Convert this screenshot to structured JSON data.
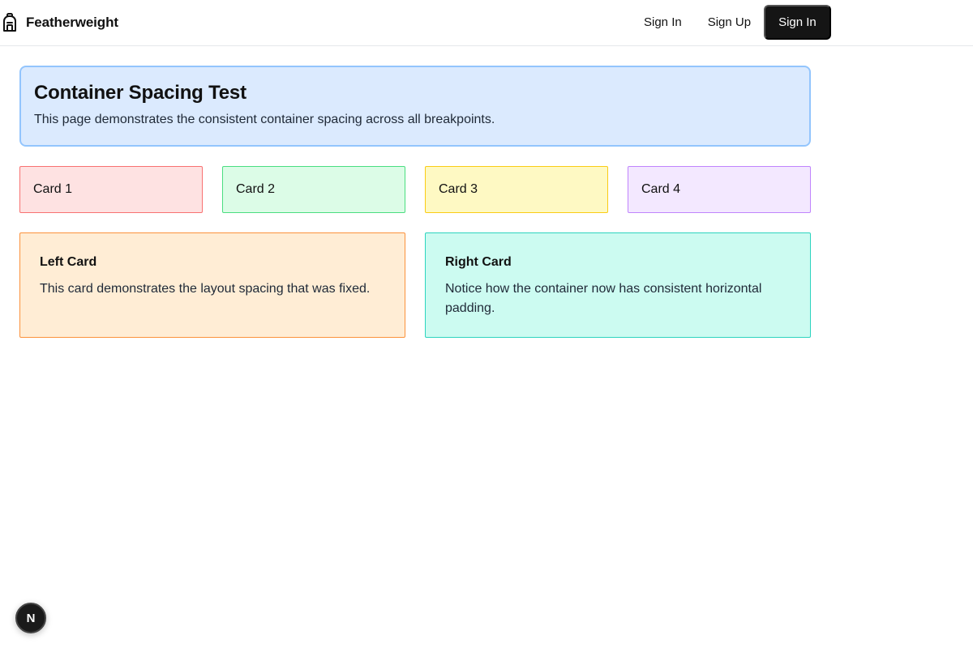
{
  "navbar": {
    "brand_icon": "backpack-icon",
    "brand_name": "Featherweight",
    "sign_in_link": "Sign In",
    "sign_up_link": "Sign Up",
    "sign_in_button": "Sign In"
  },
  "hero": {
    "title": "Container Spacing Test",
    "description": "This page demonstrates the consistent container spacing across all breakpoints."
  },
  "cards": [
    {
      "label": "Card 1",
      "color": "#fee2e2"
    },
    {
      "label": "Card 2",
      "color": "#dcfce7"
    },
    {
      "label": "Card 3",
      "color": "#fef9c3"
    },
    {
      "label": "Card 4",
      "color": "#f3e8ff"
    }
  ],
  "left_card": {
    "title": "Left Card",
    "text": "This card demonstrates the layout spacing that was fixed.",
    "color": "#ffedd5"
  },
  "right_card": {
    "title": "Right Card",
    "text": "Notice how the container now has consistent horizontal padding.",
    "color": "#ccfbf1"
  },
  "dev_badge": {
    "icon": "nextjs-icon",
    "letter": "N"
  }
}
